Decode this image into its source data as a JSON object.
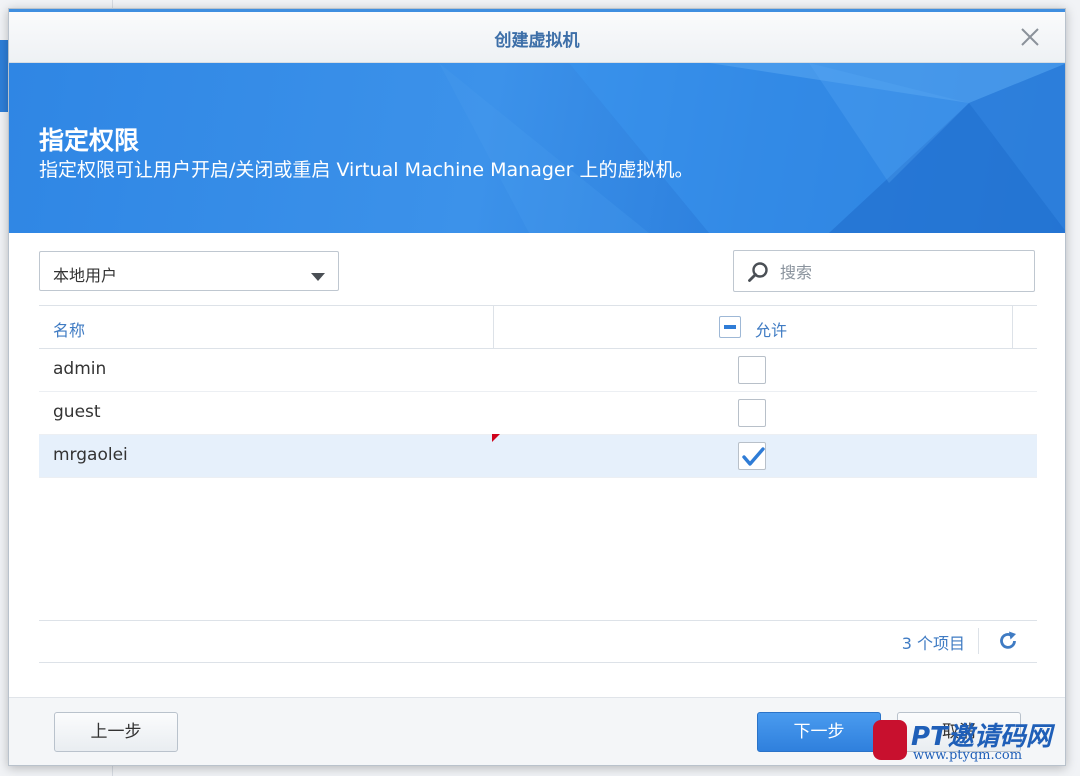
{
  "dialog": {
    "title": "创建虚拟机",
    "close_icon": "close-icon"
  },
  "banner": {
    "title": "指定权限",
    "description": "指定权限可让用户开启/关闭或重启 Virtual Machine Manager 上的虚拟机。"
  },
  "filter": {
    "selected": "本地用户"
  },
  "search": {
    "placeholder": "搜索",
    "value": ""
  },
  "table": {
    "columns": {
      "name": "名称",
      "allow": "允许"
    },
    "rows": [
      {
        "name": "admin",
        "allowed": false,
        "selected": false
      },
      {
        "name": "guest",
        "allowed": false,
        "selected": false
      },
      {
        "name": "mrgaolei",
        "allowed": true,
        "selected": true
      }
    ]
  },
  "status": {
    "count_text": "3 个项目"
  },
  "buttons": {
    "prev": "上一步",
    "next": "下一步",
    "cancel": "取消"
  },
  "watermark": {
    "text": "PT邀请码网",
    "url": "www.ptyqm.com"
  },
  "colors": {
    "accent": "#3f7bc3",
    "banner": "#2f86e4",
    "primary_button": "#2f80dd"
  }
}
